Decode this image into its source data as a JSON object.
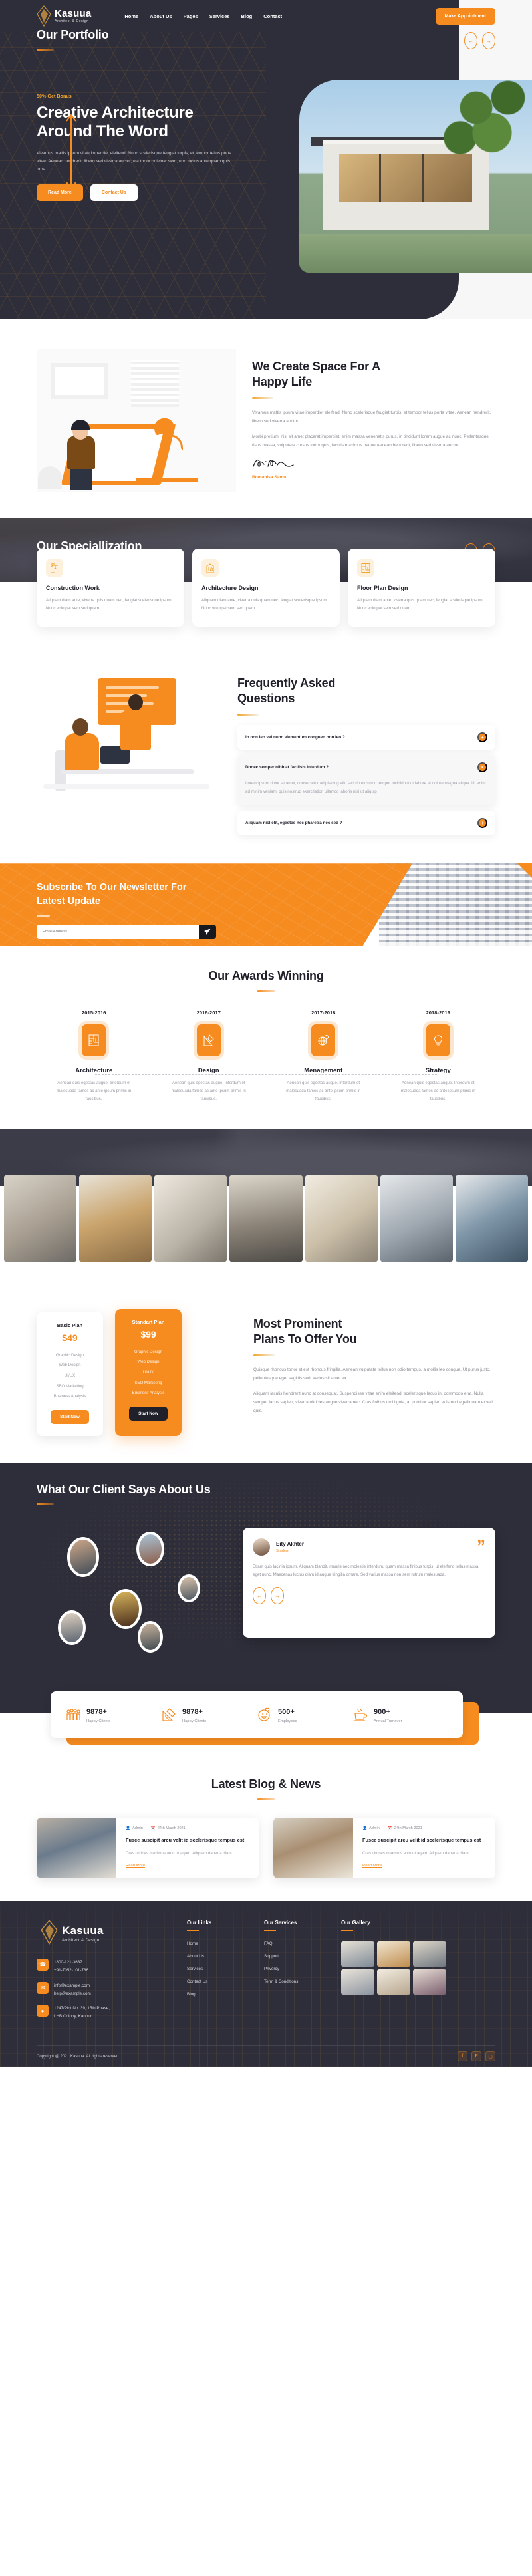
{
  "brand": {
    "name": "Kasuua",
    "tagline": "Architect & Design"
  },
  "nav": {
    "items": [
      "Home",
      "About Us",
      "Pages",
      "Services",
      "Blog",
      "Contact"
    ],
    "cta": "Make Appointment"
  },
  "hero": {
    "badge": "50% Get Bonus",
    "title_line1": "Creative Architecture",
    "title_line2": "Around The Word",
    "desc": "Vivamus mattis ipsum vitae imperdiet eleifend. Nunc scelerisque feugiat turpis, et tempor tellus porta vitae. Aenean hendrerit, libero sed viverra auctor, est tortor pulvinar sem, non luctus ante quam quis urna.",
    "btn_primary": "Read More",
    "btn_secondary": "Contact Us"
  },
  "about": {
    "title_line1": "We Create Space For A",
    "title_line2": "Happy Life",
    "para1": "Vivamus mattis ipsum vitae imperdiet eleifend. Nunc scelerisque feugiat turpis, et tempor tellus porta vitae. Aenean hendrerit, libero sed viverra auctor.",
    "para2": "Morbi pretium, nisl sit amet placerat imperdiet, enim massa venenatis purus, in tincidunt lorem augue ac nunc. Pellentesque risus massa, vulputate cursus tortor quis, iaculis maximus neque.Aenean hendrerit, libero sed viverra auctor.",
    "signature_name": "Romanisa Samu"
  },
  "specialization": {
    "title": "Our Speciallization",
    "cards": [
      {
        "icon": "crane-icon",
        "name": "Construction Work",
        "desc": "Aliquam diam ante, viverra quis quam nec, feugiat scelerisque ipsum. Nunc volutpat sem sed quam."
      },
      {
        "icon": "building-pencil-icon",
        "name": "Architecture Design",
        "desc": "Aliquam diam ante, viverra quis quam nec, feugiat scelerisque ipsum. Nunc volutpat sem sed quam."
      },
      {
        "icon": "floorplan-icon",
        "name": "Floor Plan Design",
        "desc": "Aliquam diam ante, viverra quis quam nec, feugiat scelerisque ipsum. Nunc volutpat sem sed quam."
      }
    ]
  },
  "faq": {
    "title_line1": "Frequently Asked",
    "title_line2": "Questions",
    "items": [
      {
        "q": "In non leo vel nunc elementum conguen non leo ?",
        "open": false,
        "a": ""
      },
      {
        "q": "Donec semper nibh at facilisis interdum ?",
        "open": true,
        "a": "Lorem ipsum dolor sit amet, consectetur adipisicing elit, sed do eiusmod tempor incididunt ut labore et dolore magna aliqua. Ut enim ad minim veniam, quis nostrud exercitation ullamco laboris nisi ut aliquip"
      },
      {
        "q": "Aliquam nisl elit, egestas nec pharetra nec sed ?",
        "open": false,
        "a": ""
      }
    ]
  },
  "newsletter": {
    "title_line1": "Subscribe To Our Newsletter For",
    "title_line2": "Latest Update",
    "placeholder": "Email Address...",
    "value": "",
    "submit_icon": "send-icon"
  },
  "awards": {
    "title": "Our Awards Winning",
    "items": [
      {
        "year": "2015-2016",
        "icon": "blueprint-icon",
        "name": "Architecture",
        "desc": "Aenean quis egestas augue. Interdum et malesuada fames ac ante ipsum primis in faucibus."
      },
      {
        "year": "2016-2017",
        "icon": "pencil-ruler-icon",
        "name": "Design",
        "desc": "Aenean quis egestas augue. Interdum et malesuada fames ac ante ipsum primis in faucibus."
      },
      {
        "year": "2017-2018",
        "icon": "globe-gear-icon",
        "name": "Menagement",
        "desc": "Aenean quis egestas augue. Interdum et malesuada fames ac ante ipsum primis in faucibus."
      },
      {
        "year": "2018-2019",
        "icon": "bulb-icon",
        "name": "Strategy",
        "desc": "Aenean quis egestas augue. Interdum et malesuada fames ac ante ipsum primis in faucibus."
      }
    ]
  },
  "portfolio": {
    "title": "Our Portfolio",
    "items": [
      "portfolio-architects-reviewing",
      "portfolio-workers-site",
      "portfolio-team-meeting",
      "portfolio-designer-desk",
      "portfolio-model-presentation",
      "portfolio-engineer-tablet",
      "portfolio-helmet-worker"
    ]
  },
  "pricing": {
    "plans": [
      {
        "name": "Basic Plan",
        "price": "$49",
        "features": [
          "Graphic Design",
          "Web Design",
          "UI/UX",
          "SEO Marketing",
          "Business Analysis"
        ],
        "cta": "Start Now",
        "featured": false
      },
      {
        "name": "Standart Plan",
        "price": "$99",
        "features": [
          "Graphic Design",
          "Web Design",
          "UI/UX",
          "SEO Marketing",
          "Business Analysis"
        ],
        "cta": "Start Now",
        "featured": true
      }
    ],
    "title_line1": "Most Prominent",
    "title_line2": "Plans To Offer You",
    "para1": "Quisque rhoncus tortor et est rhoncus fringilla. Aenean vulputate tellus non odio tempus, a mollis leo congue. Ut purus justo, pellentesque eget sagittis sed, varius sit amet ex.",
    "para2": "Aliquam iaculis hendrerit nunc at consequat. Suspendisse vitae enim eleifend, scelerisque lacus in, commodo erat. Nulla semper lacus sapien, viverra ultricies augue viverra nec. Cras finibus orci ligula, at porttitor sapien euismod egetliquam et velit quis."
  },
  "testimonials": {
    "title": "What Our Client Says About Us",
    "card": {
      "name": "Eity Akhter",
      "role": "Student",
      "text": "Etiam quis lacinia ipsum. Aliquam blandit, mauris nec molestie interdum, quam massa finibus turpis, ut eleifend tellus massa eget nunc. Maecenas luctus diam id augue fringilla ornare. Sed varius massa non sem rutrum malesuada.",
      "quote_icon": "quote-icon"
    },
    "faces": [
      "client-face-1",
      "client-face-2",
      "client-face-3",
      "client-face-4",
      "client-face-5",
      "client-face-6"
    ]
  },
  "counters": [
    {
      "icon": "people-icon",
      "number": "9878+",
      "label": "Happy Clients"
    },
    {
      "icon": "ruler-icon",
      "number": "9878+",
      "label": "Happy Clients"
    },
    {
      "icon": "smiley-icon",
      "number": "500+",
      "label": "Employees"
    },
    {
      "icon": "coffee-icon",
      "number": "900+",
      "label": "Annual Turnover"
    }
  ],
  "blog": {
    "title": "Latest Blog & News",
    "posts": [
      {
        "author": "Admin",
        "date": "24th March 2021",
        "title": "Fusce suscipit arcu velit id scelerisque tempus est",
        "excerpt": "Cras ultrices maximus arcu ut aqam. Aliquam daber a diam.",
        "more": "Read More",
        "thumb": "blog-thumb-model-maker"
      },
      {
        "author": "Admin",
        "date": "24th March 2021",
        "title": "Fusce suscipit arcu velit id scelerisque tempus est",
        "excerpt": "Cras ultrices maximus arcu ut aqam. Aliquam daber a diam.",
        "more": "Read More",
        "thumb": "blog-thumb-woman-office"
      }
    ]
  },
  "footer": {
    "phones": [
      "1800-121-3637",
      "+91-7052-101-786"
    ],
    "emails": [
      "info@example.com",
      "help@example.com"
    ],
    "address": [
      "1247/Plot No. 39, 15th Phase,",
      "LHB Colony, Kanpur"
    ],
    "links_title": "Our Links",
    "links": [
      "Home",
      "About Us",
      "Services",
      "Contact Us",
      "Blog"
    ],
    "services_title": "Our Services",
    "services": [
      "FAQ",
      "Support",
      "Privercy",
      "Term & Conditions"
    ],
    "gallery_title": "Our Gallery",
    "gallery": [
      "g1",
      "g2",
      "g3",
      "g4",
      "g5",
      "g6"
    ],
    "copyright": "Copyright @ 2021 Kasuua. All rights reserved.",
    "social": [
      "facebook-icon",
      "twitter-icon",
      "instagram-icon"
    ]
  },
  "colors": {
    "accent": "#f68b1f",
    "dark": "#2e2e3a",
    "muted": "#8d8d97"
  }
}
